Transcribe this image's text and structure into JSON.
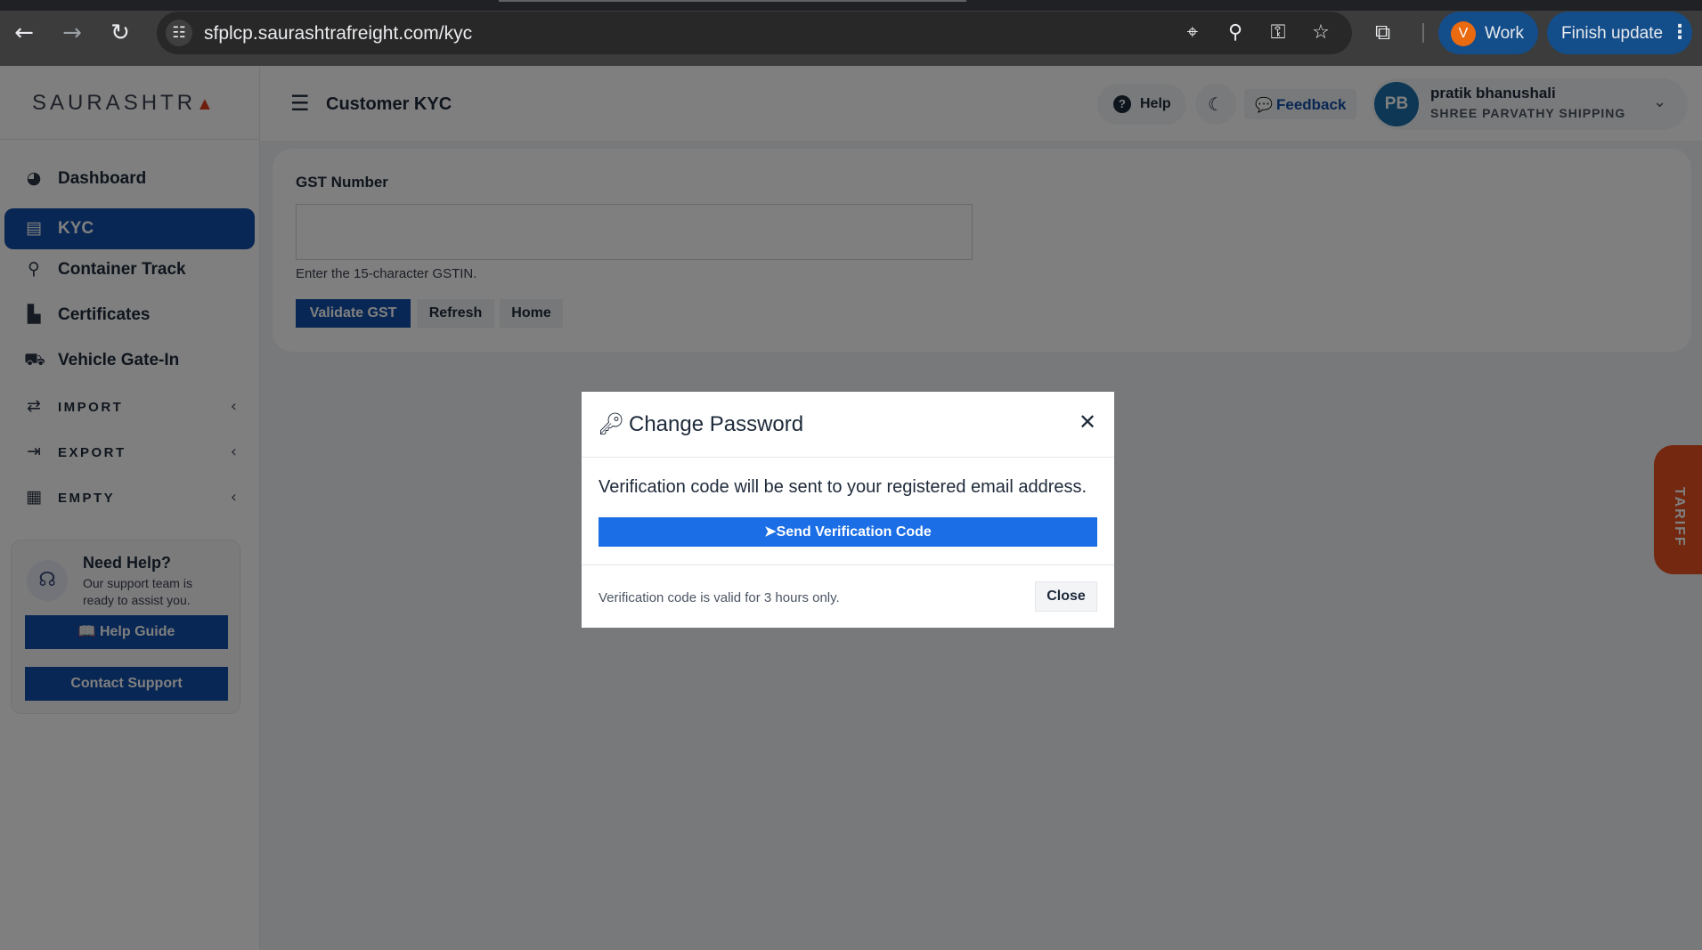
{
  "browser": {
    "url": "sfplcp.saurashtrafreight.com/kyc",
    "profile_initial": "V",
    "profile_label": "Work",
    "update_label": "Finish update"
  },
  "sidebar": {
    "logo_text": "SAURASHTR",
    "logo_mark": "▲",
    "items": [
      {
        "label": "Dashboard",
        "icon": "dashboard-icon",
        "active": false
      },
      {
        "label": "KYC",
        "icon": "id-card-icon",
        "active": true
      },
      {
        "label": "Container Track",
        "icon": "route-icon",
        "active": false
      },
      {
        "label": "Certificates",
        "icon": "certificate-icon",
        "active": false
      },
      {
        "label": "Vehicle Gate-In",
        "icon": "truck-icon",
        "active": false
      },
      {
        "label": "IMPORT",
        "icon": "swap-icon",
        "active": false
      },
      {
        "label": "EXPORT",
        "icon": "file-export-icon",
        "active": false
      },
      {
        "label": "EMPTY",
        "icon": "boxes-icon",
        "active": false
      }
    ],
    "help_card": {
      "title": "Need Help?",
      "text": "Our support team is ready to assist you.",
      "guide_label": "📖 Help Guide",
      "support_label": "Contact Support"
    }
  },
  "header": {
    "title": "Customer KYC",
    "help_label": "Help",
    "feedback_label": "Feedback",
    "user_initials": "PB",
    "user_name": "pratik bhanushali",
    "user_company": "SHREE PARVATHY SHIPPING"
  },
  "kyc_form": {
    "gst_label": "GST Number",
    "gst_value": "",
    "gst_placeholder": "",
    "gst_help": "Enter the 15-character GSTIN.",
    "validate_label": "Validate GST",
    "refresh_label": "Refresh",
    "home_label": "Home"
  },
  "modal": {
    "title": "Change Password",
    "message": "Verification code will be sent to your registered email address.",
    "send_label": "Send Verification Code",
    "note": "Verification code is valid for 3 hours only.",
    "close_label": "Close"
  },
  "tariff_label": "TARIFF",
  "colors": {
    "primary": "#134fa8",
    "send_button": "#1b6ee6",
    "tariff": "#e9501e",
    "logo_accent": "#dd3b1c"
  }
}
